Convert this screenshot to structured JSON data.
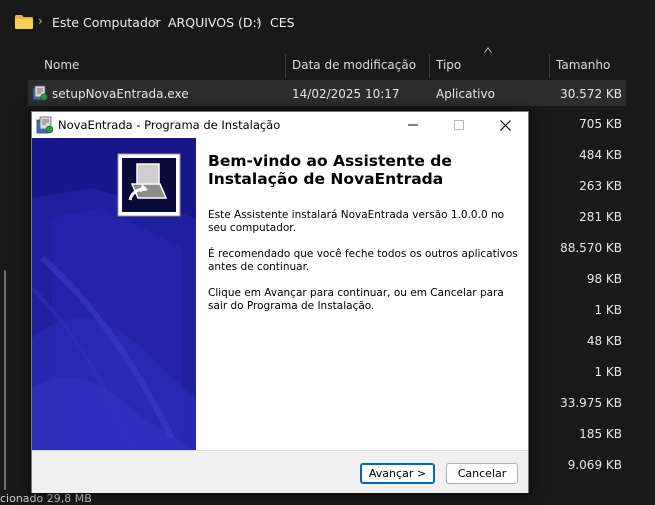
{
  "breadcrumb": {
    "items": [
      "Este Computador",
      "ARQUIVOS (D:)",
      "CES"
    ],
    "folder_icon": "folder-icon",
    "separator_icon": "chevron-right-icon"
  },
  "columns": {
    "name": "Nome",
    "modified": "Data de modificação",
    "type": "Tipo",
    "size": "Tamanho"
  },
  "selected_file": {
    "name": "setupNovaEntrada.exe",
    "modified": "14/02/2025 10:17",
    "type": "Aplicativo",
    "size": "30.572 KB"
  },
  "other_sizes": [
    "705 KB",
    "484 KB",
    "263 KB",
    "281 KB",
    "88.570 KB",
    "98 KB",
    "1 KB",
    "48 KB",
    "1 KB",
    "33.975 KB",
    "185 KB",
    "9.069 KB"
  ],
  "status_bar": {
    "text": "cionado  29,8 MB"
  },
  "installer": {
    "window_title": "NovaEntrada - Programa de Instalação",
    "heading": "Bem-vindo ao Assistente de Instalação de NovaEntrada",
    "paragraphs": [
      "Este Assistente instalará NovaEntrada versão 1.0.0.0 no seu computador.",
      "É recomendado que você feche todos os outros aplicativos antes de continuar.",
      "Clique em Avançar para continuar, ou em Cancelar para sair do Programa de Instalação."
    ],
    "next_button": "Avançar >",
    "cancel_button": "Cancelar"
  },
  "colors": {
    "explorer_bg": "#191919",
    "selected_row": "#2d2d2d",
    "banner_blue": "#17168a",
    "accent": "#0067c0"
  }
}
